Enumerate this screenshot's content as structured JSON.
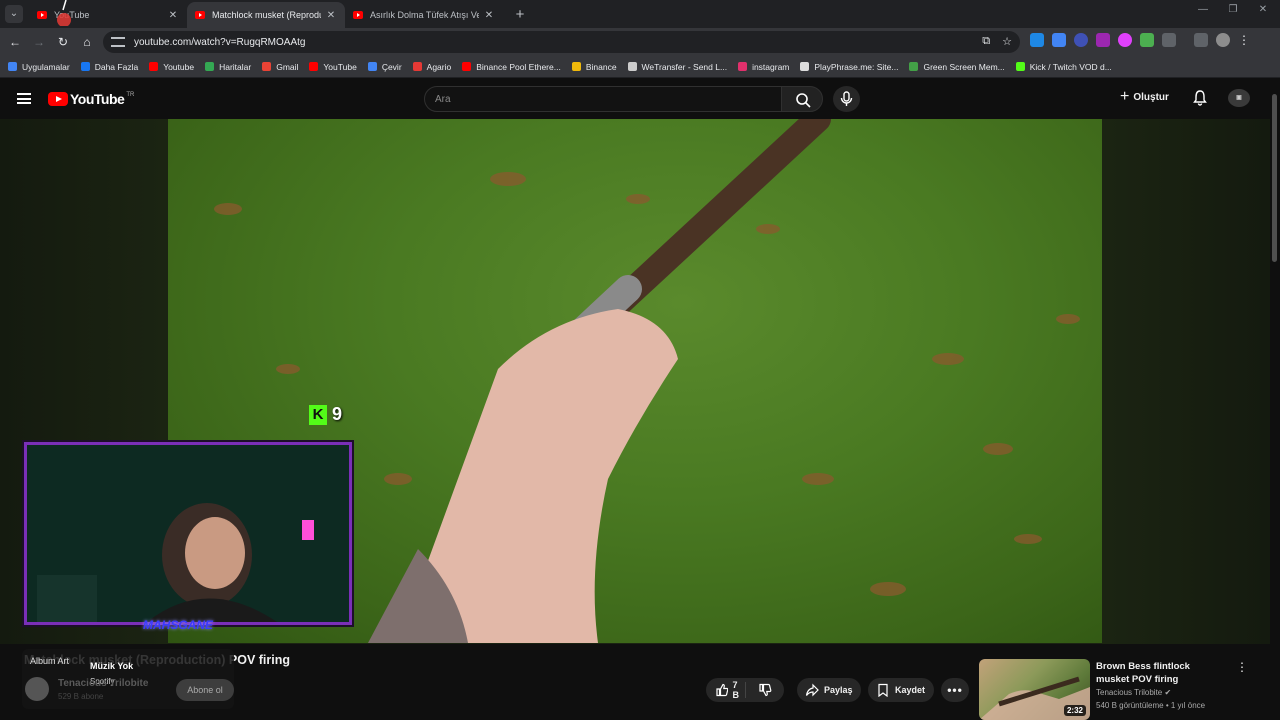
{
  "browser": {
    "tabs": [
      {
        "title": "YouTube",
        "active": false
      },
      {
        "title": "Matchlock musket (Reproduction) POV firing",
        "active": true
      },
      {
        "title": "Asırlık Dolma Tüfek Atışı Ve Pat...",
        "active": false
      }
    ],
    "new_tab": "+",
    "url": "youtube.com/watch?v=RugqRMOAAtg"
  },
  "bookmarks": [
    {
      "label": "Uygulamalar",
      "color": "#4285f4"
    },
    {
      "label": "Daha Fazla",
      "color": "#1877f2"
    },
    {
      "label": "Youtube",
      "color": "#ff0000"
    },
    {
      "label": "Haritalar",
      "color": "#34a853"
    },
    {
      "label": "Gmail",
      "color": "#ea4335"
    },
    {
      "label": "YouTube",
      "color": "#ff0000"
    },
    {
      "label": "Çevir",
      "color": "#4285f4"
    },
    {
      "label": "Agario",
      "color": "#e53935"
    },
    {
      "label": "Binance Pool Ethere...",
      "color": "#ff0000"
    },
    {
      "label": "Binance",
      "color": "#f0b90b"
    },
    {
      "label": "WeTransfer - Send L...",
      "color": "#cccccc"
    },
    {
      "label": "instagram",
      "color": "#e1306c"
    },
    {
      "label": "PlayPhrase.me: Site...",
      "color": "#dddddd"
    },
    {
      "label": "Green Screen Mem...",
      "color": "#43a047"
    },
    {
      "label": "Kick / Twitch VOD d...",
      "color": "#53fc18"
    }
  ],
  "youtube": {
    "logo": "YouTube",
    "country": "TR",
    "search_placeholder": "Ara",
    "create_label": "Oluştur"
  },
  "overlay": {
    "kick_viewers": "9",
    "webcam_label": "MAHSGANE"
  },
  "video": {
    "title": "Matchlock musket (Reproduction) POV firing",
    "channel": "Tenacious Trilobite",
    "subscribers": "529 B abone",
    "subscribe_label": "Abone ol",
    "likes": "7 B",
    "share_label": "Paylaş",
    "save_label": "Kaydet",
    "more": "•••"
  },
  "spotify": {
    "album_art": "Album Art",
    "now_playing": "Müzik Yok",
    "source": "Spotify"
  },
  "recommendation": {
    "title": "Brown Bess flintlock musket POV firing",
    "channel": "Tenacious Trilobite",
    "meta": "540 B görüntüleme • 1 yıl önce",
    "duration": "2:32"
  }
}
